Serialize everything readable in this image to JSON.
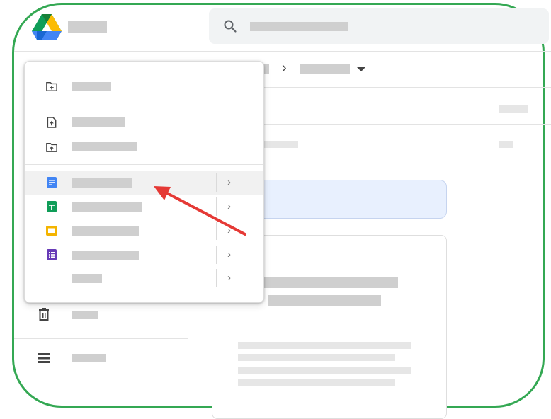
{
  "header": {
    "logo_icon": "google-drive-logo",
    "app_title": "",
    "search_placeholder": ""
  },
  "breadcrumb": {
    "separator": "›",
    "current": "",
    "dropdown_icon": "caret-down-icon"
  },
  "new_menu": {
    "items": [
      {
        "icon": "new-folder-icon",
        "label": ""
      },
      {
        "icon": "file-upload-icon",
        "label": ""
      },
      {
        "icon": "folder-upload-icon",
        "label": ""
      },
      {
        "icon": "google-docs-icon",
        "label": "",
        "has_submenu": true,
        "highlighted": true
      },
      {
        "icon": "google-sheets-icon",
        "label": "",
        "has_submenu": true
      },
      {
        "icon": "google-slides-icon",
        "label": "",
        "has_submenu": true
      },
      {
        "icon": "google-forms-icon",
        "label": "",
        "has_submenu": true
      },
      {
        "icon": "more-icon",
        "label": "",
        "has_submenu": true
      }
    ],
    "submenu_chevron": "›"
  },
  "sidebar": {
    "items": [
      {
        "icon": "trash-icon",
        "label": ""
      },
      {
        "icon": "storage-icon",
        "label": ""
      }
    ]
  },
  "annotation": {
    "type": "arrow",
    "color": "#e53935"
  },
  "colors": {
    "frame_border": "#34a853",
    "docs_blue": "#4285f4",
    "sheets_green": "#0f9d58",
    "slides_yellow": "#f4b400",
    "forms_purple": "#673ab7",
    "chip_bg": "#e8f0fe"
  }
}
